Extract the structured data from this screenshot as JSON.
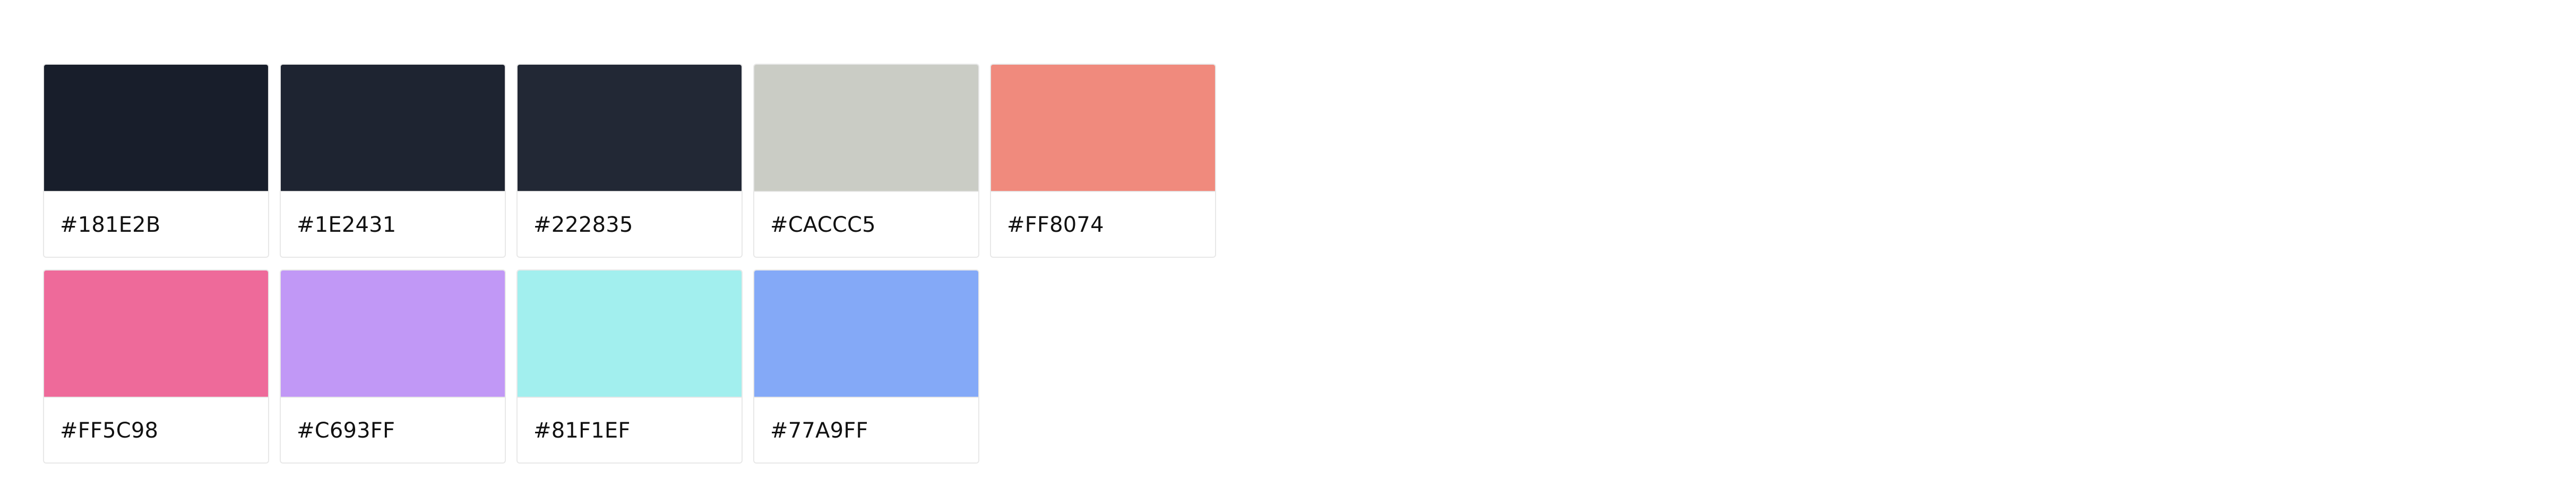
{
  "palette": {
    "swatches": [
      {
        "hex": "#181E2B",
        "color": "#181E2B"
      },
      {
        "hex": "#1E2431",
        "color": "#1E2431"
      },
      {
        "hex": "#222835",
        "color": "#222835"
      },
      {
        "hex": "#CACCC5",
        "color": "#CACCC5"
      },
      {
        "hex": "#FF8074",
        "color": "#F08A7D"
      },
      {
        "hex": "#FF5C98",
        "color": "#EE6A9A"
      },
      {
        "hex": "#C693FF",
        "color": "#C198F6"
      },
      {
        "hex": "#81F1EF",
        "color": "#A2EFEE"
      },
      {
        "hex": "#77A9FF",
        "color": "#84A9F7"
      }
    ]
  }
}
